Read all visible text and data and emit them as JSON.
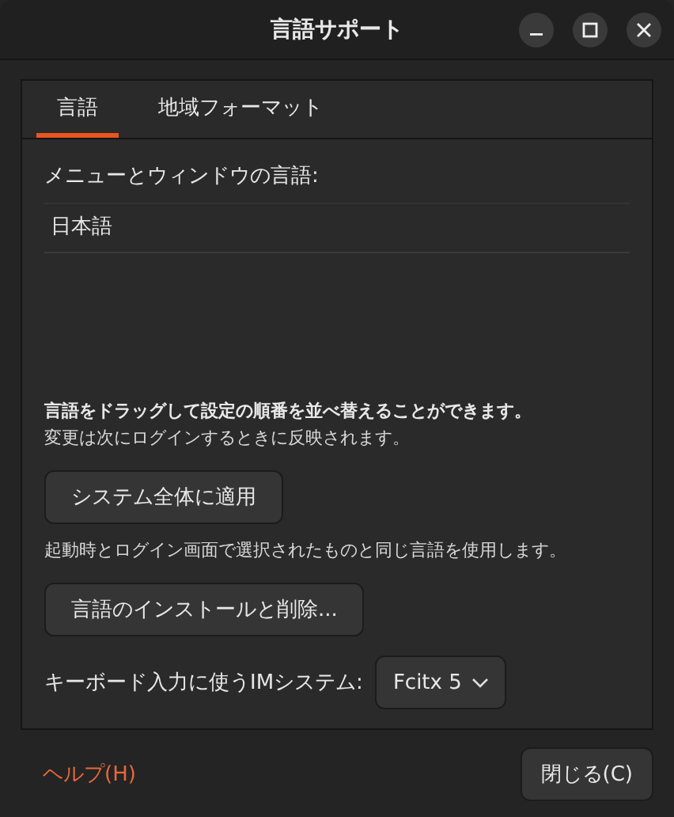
{
  "window": {
    "title": "言語サポート"
  },
  "tabs": [
    {
      "label": "言語",
      "selected": true
    },
    {
      "label": "地域フォーマット",
      "selected": false
    }
  ],
  "language_section": {
    "heading": "メニューとウィンドウの言語:",
    "languages": [
      "日本語"
    ],
    "hint_bold": "言語をドラッグして設定の順番を並べ替えることができます。",
    "hint": "変更は次にログインするときに反映されます。"
  },
  "apply_button": "システム全体に適用",
  "apply_note": "起動時とログイン画面で選択されたものと同じ言語を使用します。",
  "install_button": "言語のインストールと削除...",
  "im": {
    "label": "キーボード入力に使うIMシステム:",
    "value": "Fcitx 5"
  },
  "help_link": "ヘルプ(H)",
  "close_button": "閉じる(C)"
}
